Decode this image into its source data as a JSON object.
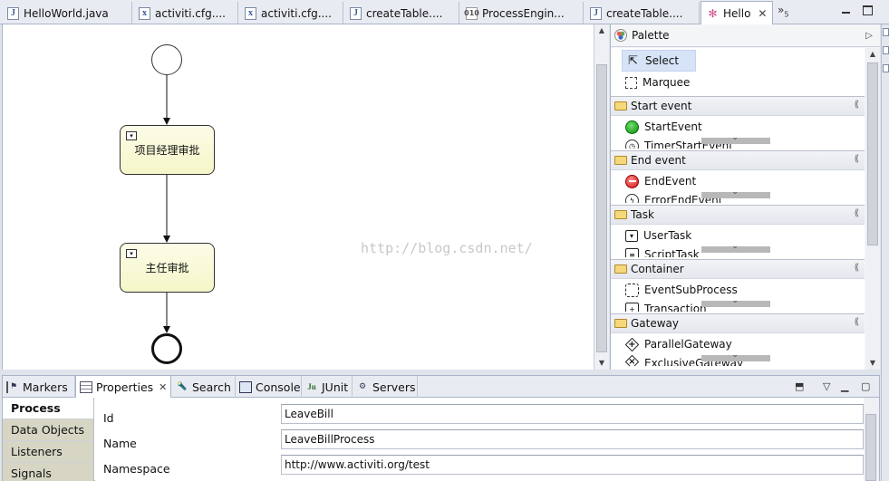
{
  "editor": {
    "tabs": [
      {
        "label": "HelloWorld.java",
        "icon": "java-file-icon"
      },
      {
        "label": "activiti.cfg....",
        "icon": "xml-file-icon"
      },
      {
        "label": "activiti.cfg....",
        "icon": "xml-file-icon"
      },
      {
        "label": "createTable....",
        "icon": "java-file-icon"
      },
      {
        "label": "ProcessEngin...",
        "icon": "class-file-icon"
      },
      {
        "label": "createTable....",
        "icon": "java-file-icon"
      },
      {
        "label": "Hello",
        "icon": "activiti-diagram-icon"
      }
    ],
    "overflow_label": "»",
    "overflow_count": "5"
  },
  "diagram": {
    "tasks": [
      {
        "label": "项目经理审批"
      },
      {
        "label": "主任审批"
      }
    ],
    "watermark": "http://blog.csdn.net/"
  },
  "palette": {
    "title": "Palette",
    "tools": [
      {
        "label": "Select",
        "icon": "cursor-icon"
      },
      {
        "label": "Marquee",
        "icon": "marquee-icon"
      }
    ],
    "drawers": [
      {
        "label": "Start event",
        "items": [
          "StartEvent",
          "TimerStartEvent"
        ]
      },
      {
        "label": "End event",
        "items": [
          "EndEvent",
          "ErrorEndEvent"
        ]
      },
      {
        "label": "Task",
        "items": [
          "UserTask",
          "ScriptTask"
        ]
      },
      {
        "label": "Container",
        "items": [
          "EventSubProcess",
          "Transaction"
        ]
      },
      {
        "label": "Gateway",
        "items": [
          "ParallelGateway",
          "ExclusiveGateway"
        ]
      }
    ]
  },
  "views": {
    "tabs": [
      {
        "label": "Markers"
      },
      {
        "label": "Properties"
      },
      {
        "label": "Search"
      },
      {
        "label": "Console"
      },
      {
        "label": "JUnit"
      },
      {
        "label": "Servers"
      }
    ],
    "side_tabs": [
      "Process",
      "Data Objects",
      "Listeners",
      "Signals"
    ],
    "fields": [
      {
        "label": "Id",
        "value": "LeaveBill"
      },
      {
        "label": "Name",
        "value": "LeaveBillProcess"
      },
      {
        "label": "Namespace",
        "value": "http://www.activiti.org/test"
      }
    ]
  }
}
